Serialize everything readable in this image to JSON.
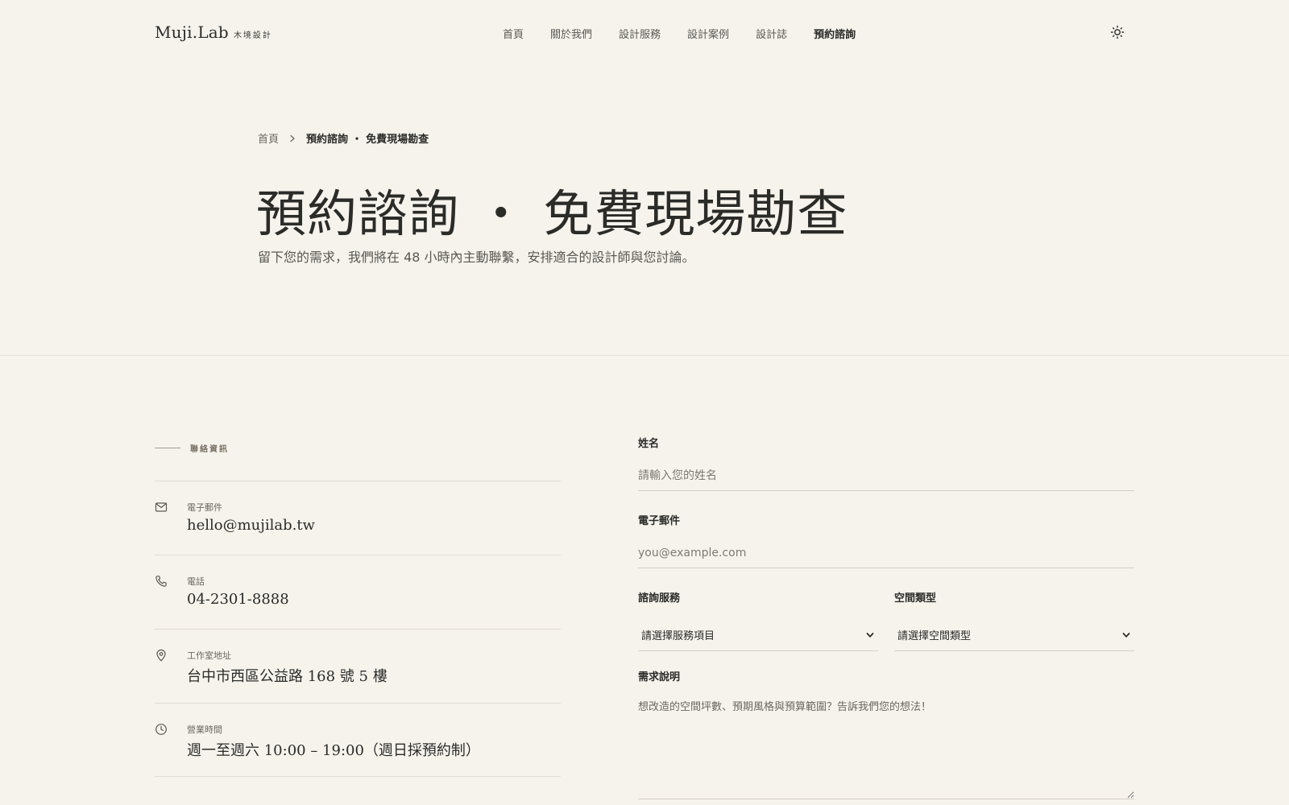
{
  "header": {
    "logo_main": "Muji.Lab",
    "logo_sub": "木境設計",
    "nav": [
      {
        "label": "首頁",
        "active": false
      },
      {
        "label": "關於我們",
        "active": false
      },
      {
        "label": "設計服務",
        "active": false
      },
      {
        "label": "設計案例",
        "active": false
      },
      {
        "label": "設計誌",
        "active": false
      },
      {
        "label": "預約諮詢",
        "active": true
      }
    ],
    "theme_toggle_icon": "sun-icon"
  },
  "breadcrumb": {
    "home": "首頁",
    "current": "預約諮詢 ・ 免費現場勘查"
  },
  "hero": {
    "title": "預約諮詢 ・ 免費現場勘查",
    "description": "留下您的需求，我們將在 48 小時內主動聯繫，安排適合的設計師與您討論。"
  },
  "contact": {
    "section_label": "聯絡資訊",
    "items": [
      {
        "icon": "mail-icon",
        "label": "電子郵件",
        "value": "hello@mujilab.tw"
      },
      {
        "icon": "phone-icon",
        "label": "電話",
        "value": "04-2301-8888"
      },
      {
        "icon": "map-pin-icon",
        "label": "工作室地址",
        "value": "台中市西區公益路 168 號 5 樓"
      },
      {
        "icon": "clock-icon",
        "label": "營業時間",
        "value": "週一至週六 10:00 – 19:00（週日採預約制）"
      }
    ]
  },
  "form": {
    "name": {
      "label": "姓名",
      "placeholder": "請輸入您的姓名"
    },
    "email": {
      "label": "電子郵件",
      "placeholder": "you@example.com"
    },
    "service": {
      "label": "諮詢服務",
      "selected": "請選擇服務項目"
    },
    "space": {
      "label": "空間類型",
      "selected": "請選擇空間類型"
    },
    "details": {
      "label": "需求說明",
      "placeholder": "想改造的空間坪數、預期風格與預算範圍？告訴我們您的想法！"
    }
  },
  "colors": {
    "background": "#f6f3ed",
    "text": "#2b2b28",
    "muted": "#6b6862",
    "accent_line": "#a49c8d"
  }
}
